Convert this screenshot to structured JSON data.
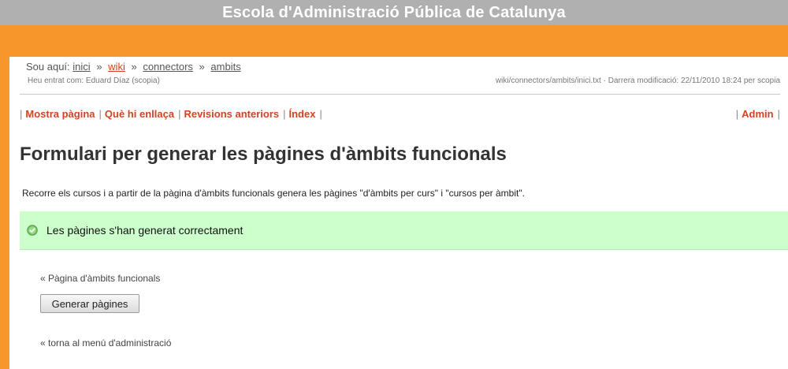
{
  "site": {
    "title": "Escola d'Administració Pública de Catalunya"
  },
  "breadcrumb": {
    "prefix": "Sou aquí:",
    "items": [
      {
        "label": "inici"
      },
      {
        "label": "wiki"
      },
      {
        "label": "connectors"
      },
      {
        "label": "ambits"
      }
    ],
    "separator": "»"
  },
  "user": {
    "logged_in_text": "Heu entrat com: Eduard Díaz (scopia)"
  },
  "page_meta": {
    "text": "wiki/connectors/ambits/inici.txt · Darrera modificació: 22/11/2010 18:24 per scopia"
  },
  "toolbar": {
    "items": [
      {
        "label": "Mostra pàgina"
      },
      {
        "label": "Què hi enllaça"
      },
      {
        "label": "Revisions anteriors"
      },
      {
        "label": "Índex"
      }
    ],
    "admin_label": "Admin",
    "separator": "|"
  },
  "main": {
    "title": "Formulari per generar les pàgines d'àmbits funcionals",
    "intro": "Recorre els cursos i a partir de la pàgina d'àmbits funcionals genera les pàgines \"d'àmbits per curs\" i \"cursos per àmbit\".",
    "success_message": "Les pàgines s'han generat correctament",
    "back_link_ambits": "« Pàgina d'àmbits funcionals",
    "generate_button": "Generar pàgines",
    "back_link_admin": "« torna al menú d'administració"
  },
  "colors": {
    "accent": "#f7962a",
    "link": "#d4431f",
    "success_bg": "#ccffcc",
    "top_bar": "#b0b0b0"
  }
}
